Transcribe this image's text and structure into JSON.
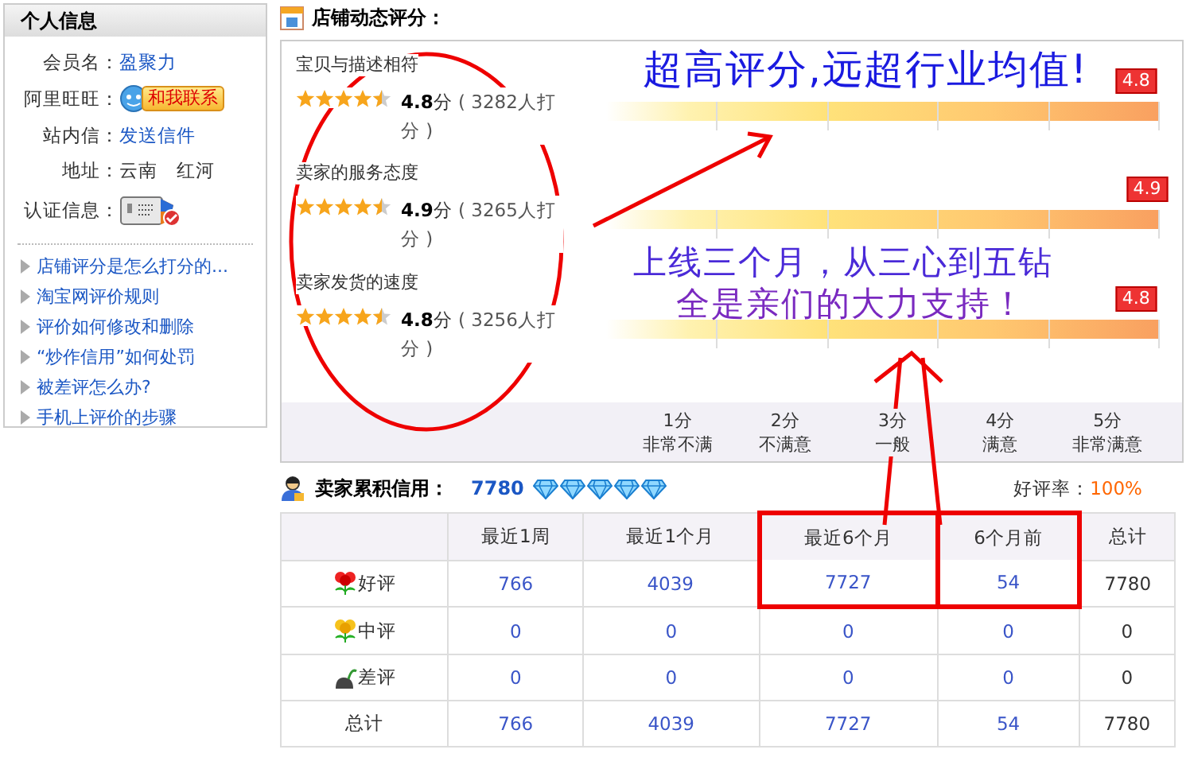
{
  "profile": {
    "title": "个人信息",
    "fields": [
      {
        "label": "会员名：",
        "kind": "link",
        "value": "盈聚力"
      },
      {
        "label": "阿里旺旺：",
        "kind": "contact",
        "value": "和我联系"
      },
      {
        "label": "站内信：",
        "kind": "link",
        "value": "发送信件"
      },
      {
        "label": "地址：",
        "kind": "text",
        "value": "云南　红河"
      },
      {
        "label": "认证信息：",
        "kind": "certificate"
      }
    ],
    "links": [
      "店铺评分是怎么打分的...",
      "淘宝网评价规则",
      "评价如何修改和删除",
      "“炒作信用”如何处罚",
      "被差评怎么办?",
      "手机上评价的步骤"
    ]
  },
  "shop_rating": {
    "title": "店铺动态评分：",
    "items": [
      {
        "name": "宝贝与描述相符",
        "stars": 4.5,
        "score": "4.8",
        "unit": "分",
        "count": "( 3282人打分 )",
        "marker": "4.8",
        "level": 0.96
      },
      {
        "name": "卖家的服务态度",
        "stars": 4.5,
        "score": "4.9",
        "unit": "分",
        "count": "( 3265人打分 )",
        "marker": "4.9",
        "level": 0.98
      },
      {
        "name": "卖家发货的速度",
        "stars": 4.5,
        "score": "4.8",
        "unit": "分",
        "count": "( 3256人打分 )",
        "marker": "4.8",
        "level": 0.96
      }
    ],
    "scale": [
      {
        "score": "1分",
        "meaning": "非常不满"
      },
      {
        "score": "2分",
        "meaning": "不满意"
      },
      {
        "score": "3分",
        "meaning": "一般"
      },
      {
        "score": "4分",
        "meaning": "满意"
      },
      {
        "score": "5分",
        "meaning": "非常满意"
      }
    ]
  },
  "annotations": [
    {
      "kind": "headline",
      "text": "超高评分,远超行业均值!"
    },
    {
      "kind": "note",
      "text": "上线三个月，从三心到五钻"
    },
    {
      "kind": "note",
      "text": "全是亲们的大力支持！"
    }
  ],
  "credit": {
    "title": "卖家累积信用：",
    "score": "7780",
    "rate_label": "好评率：",
    "rate": "100%",
    "columns": [
      {
        "label": "最近1周",
        "highlighted": false
      },
      {
        "label": "最近1个月",
        "highlighted": false
      },
      {
        "label": "最近6个月",
        "highlighted": true
      },
      {
        "label": "6个月前",
        "highlighted": true
      },
      {
        "label": "总计",
        "highlighted": false
      }
    ],
    "rows": [
      {
        "kind": "good",
        "label": "好评",
        "cells": [
          "766",
          "4039",
          "7727",
          "54",
          "7780"
        ]
      },
      {
        "kind": "neutral",
        "label": "中评",
        "cells": [
          "0",
          "0",
          "0",
          "0",
          "0"
        ]
      },
      {
        "kind": "bad",
        "label": "差评",
        "cells": [
          "0",
          "0",
          "0",
          "0",
          "0"
        ]
      },
      {
        "kind": "total",
        "label": "总计",
        "cells": [
          "766",
          "4039",
          "7727",
          "54",
          "7780"
        ]
      }
    ]
  }
}
